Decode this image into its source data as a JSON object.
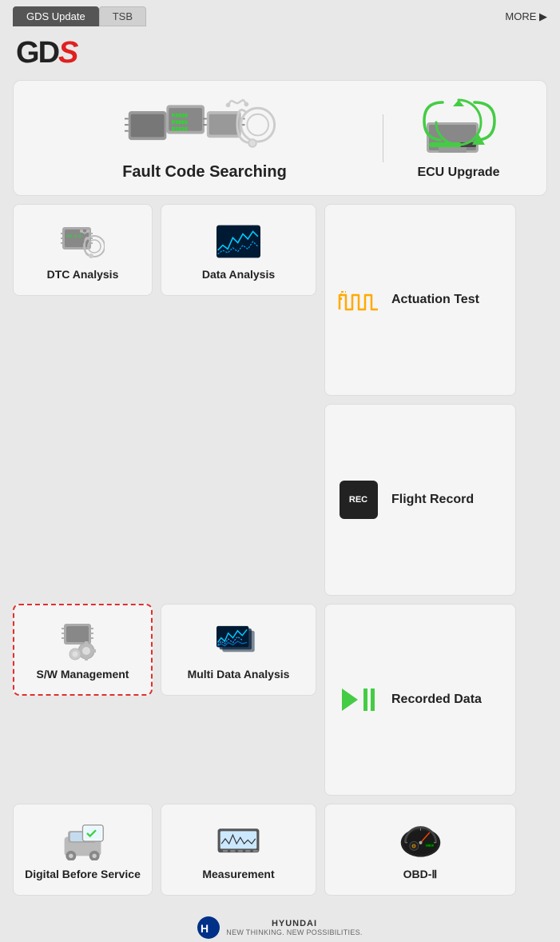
{
  "tabs": [
    {
      "id": "gds-update",
      "label": "GDS Update",
      "active": true
    },
    {
      "id": "tsb",
      "label": "TSB",
      "active": false
    }
  ],
  "more_button": "MORE ▶",
  "logo": {
    "g": "G",
    "d": "D",
    "s": "S"
  },
  "cards": {
    "fault_code": {
      "label": "Fault Code Searching",
      "codes": [
        "P3026",
        "P3665",
        "R3026"
      ]
    },
    "ecu_upgrade": {
      "label": "ECU Upgrade"
    },
    "dtc_analysis": {
      "label": "DTC Analysis"
    },
    "data_analysis": {
      "label": "Data Analysis"
    },
    "actuation_test": {
      "label": "Actuation\nTest"
    },
    "flight_record": {
      "label": "Flight\nRecord"
    },
    "sw_management": {
      "label": "S/W Management",
      "selected": true
    },
    "multi_data_analysis": {
      "label": "Multi Data Analysis"
    },
    "recorded_data": {
      "label": "Recorded\nData"
    },
    "digital_before_service": {
      "label": "Digital Before\nService"
    },
    "measurement": {
      "label": "Measurement"
    },
    "obd2": {
      "label": "OBD-Ⅱ"
    }
  },
  "footer": {
    "brand": "HYUNDAI",
    "tagline": "NEW THINKING.\nNEW POSSIBILITIES."
  }
}
